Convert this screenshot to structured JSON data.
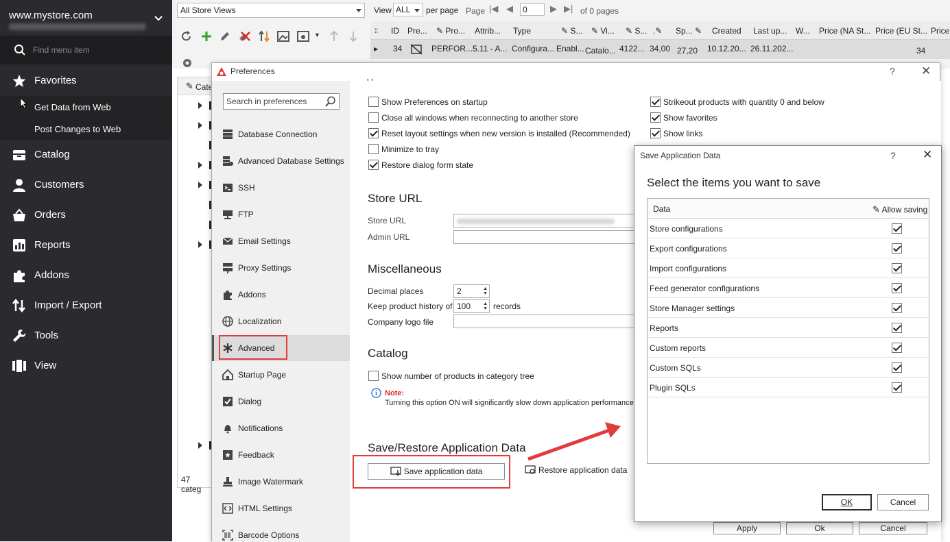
{
  "sidebar": {
    "store_name": "www.mystore.com",
    "search_placeholder": "Find menu item",
    "items": [
      {
        "label": "Favorites",
        "icon": "star-icon"
      },
      {
        "label": "Catalog",
        "icon": "box-icon"
      },
      {
        "label": "Customers",
        "icon": "user-icon"
      },
      {
        "label": "Orders",
        "icon": "basket-icon"
      },
      {
        "label": "Reports",
        "icon": "chart-icon"
      },
      {
        "label": "Addons",
        "icon": "puzzle-icon"
      },
      {
        "label": "Import / Export",
        "icon": "arrows-icon"
      },
      {
        "label": "Tools",
        "icon": "wrench-icon"
      },
      {
        "label": "View",
        "icon": "columns-icon"
      }
    ],
    "favorites": [
      "Get Data from Web",
      "Post Changes to Web"
    ]
  },
  "topbar": {
    "store_view": "All Store Views",
    "view_label": "View",
    "view_value": "ALL",
    "per_page": "per page",
    "page_label": "Page",
    "page_value": "0",
    "of_pages": "of 0 pages",
    "columns": [
      "ID",
      "Pre...",
      "Pro...",
      "Attrib...",
      "Type",
      "S...",
      "Vi...",
      "S...",
      "",
      "Sp...",
      "Created",
      "Last up...",
      "W...",
      "Price (NA St...",
      "Price (EU St...",
      "Price"
    ],
    "row": [
      "34",
      "PERFOR...",
      "5.11 - A...",
      "Configura...",
      "Enabl...",
      "Catalo...",
      "4122...",
      "34,00",
      "27,20",
      "10.12.20...",
      "26.11.202...",
      "34"
    ]
  },
  "catpanel": {
    "header": "Cate",
    "footer": "47 categ"
  },
  "preferences": {
    "title": "Preferences",
    "help": "?",
    "close": "✕",
    "search_placeholder": "Search in preferences",
    "nav": [
      {
        "label": "Database Connection",
        "icon": "database-icon"
      },
      {
        "label": "Advanced Database Settings",
        "icon": "database-gear-icon"
      },
      {
        "label": "SSH",
        "icon": "terminal-icon"
      },
      {
        "label": "FTP",
        "icon": "ftp-icon"
      },
      {
        "label": "Email Settings",
        "icon": "envelope-icon"
      },
      {
        "label": "Proxy Settings",
        "icon": "network-icon"
      },
      {
        "label": "Addons",
        "icon": "puzzle-icon"
      },
      {
        "label": "Localization",
        "icon": "globe-icon"
      },
      {
        "label": "Advanced",
        "icon": "asterisk-icon"
      },
      {
        "label": "Startup Page",
        "icon": "home-icon"
      },
      {
        "label": "Dialog",
        "icon": "checkbox-icon"
      },
      {
        "label": "Notifications",
        "icon": "bell-icon"
      },
      {
        "label": "Feedback",
        "icon": "feedback-icon"
      },
      {
        "label": "Image Watermark",
        "icon": "stamp-icon"
      },
      {
        "label": "HTML Settings",
        "icon": "code-icon"
      },
      {
        "label": "Barcode Options",
        "icon": "barcode-icon"
      }
    ],
    "checks_left": [
      {
        "label": "Show Preferences on startup",
        "checked": false
      },
      {
        "label": "Close all windows when reconnecting to another store",
        "checked": false
      },
      {
        "label": "Reset layout settings when new version is installed (Recommended)",
        "checked": true
      },
      {
        "label": "Minimize to tray",
        "checked": false
      },
      {
        "label": "Restore dialog form state",
        "checked": true
      }
    ],
    "checks_right": [
      {
        "label": "Strikeout products with quantity 0 and below",
        "checked": true
      },
      {
        "label": "Show favorites",
        "checked": true
      },
      {
        "label": "Show links",
        "checked": true
      }
    ],
    "store_url_heading": "Store URL",
    "store_url_label": "Store URL",
    "admin_url_label": "Admin URL",
    "misc_heading": "Miscellaneous",
    "decimal_label": "Decimal places",
    "decimal_value": "2",
    "history_label": "Keep product history of",
    "history_value": "100",
    "history_unit": "records",
    "logo_label": "Company logo file",
    "catalog_heading": "Catalog",
    "catalog_check": "Show number of products in category tree",
    "note_label": "Note:",
    "note_text": "Turning this option ON will significantly slow down application performance e",
    "saverestore_heading": "Save/Restore Application Data",
    "save_btn": "Save application data",
    "restore_btn": "Restore application data",
    "bottom_btns": [
      "Apply",
      "Ok",
      "Cancel"
    ]
  },
  "save_dialog": {
    "title": "Save Application Data",
    "help": "?",
    "close": "✕",
    "heading": "Select the items you want to save",
    "col_data": "Data",
    "col_allow": "Allow saving",
    "rows": [
      {
        "label": "Store configurations",
        "checked": true
      },
      {
        "label": "Export configurations",
        "checked": true
      },
      {
        "label": "Import configurations",
        "checked": true
      },
      {
        "label": "Feed generator configurations",
        "checked": true
      },
      {
        "label": "Store Manager settings",
        "checked": true
      },
      {
        "label": "Reports",
        "checked": true
      },
      {
        "label": "Custom reports",
        "checked": true
      },
      {
        "label": "Custom SQLs",
        "checked": true
      },
      {
        "label": "Plugin SQLs",
        "checked": true
      }
    ],
    "ok": "OK",
    "cancel": "Cancel"
  },
  "colors": {
    "sidebar_bg": "#2b2b2f",
    "highlight": "#e03c3c",
    "add_green": "#2aa52a",
    "delete_red": "#d42a2a"
  }
}
